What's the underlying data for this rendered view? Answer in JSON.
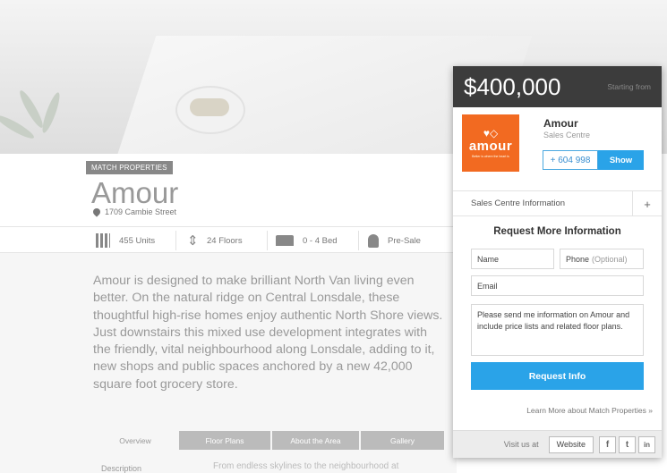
{
  "listing": {
    "tag": "MATCH PROPERTIES",
    "title": "Amour",
    "address": "1709 Cambie Street"
  },
  "stats": [
    {
      "icon": "building-icon",
      "label": "455 Units"
    },
    {
      "icon": "height-icon",
      "label": "24 Floors"
    },
    {
      "icon": "bed-icon",
      "label": "0 - 4 Bed"
    },
    {
      "icon": "person-icon",
      "label": "Pre-Sale"
    }
  ],
  "description": "Amour is designed to make brilliant North Van living even better. On the natural ridge on Central Lonsdale, these thoughtful high-rise homes enjoy authentic North Shore views. Just downstairs this mixed use development integrates with the friendly, vital neighbourhood along Lonsdale, adding to it, new shops and public spaces anchored by a new 42,000 square foot grocery store.",
  "tabs": [
    "Overview",
    "Floor Plans",
    "About the Area",
    "Gallery"
  ],
  "bottom": {
    "label": "Description",
    "text": "From endless skylines to the neighbourhood at"
  },
  "panel": {
    "price": "$400,000",
    "starting": "Starting from",
    "logo": {
      "word": "amour",
      "tagline": "Better is where the heart is"
    },
    "builder_name": "Amour",
    "builder_sub": "Sales Centre",
    "phone": "+ 604 998",
    "show": "Show",
    "accordion": "Sales Centre Information",
    "accordion_toggle": "+",
    "form_title": "Request More Information",
    "name_placeholder": "Name",
    "phone_placeholder": "Phone",
    "phone_optional": "(Optional)",
    "email_placeholder": "Email",
    "message": "Please send me information on Amour and include price lists and related floor plans.",
    "request_btn": "Request Info",
    "learn_more": "Learn More about Match Properties »",
    "visit": "Visit us at",
    "website": "Website",
    "social": [
      "f",
      "t",
      "in"
    ]
  },
  "colors": {
    "accent": "#2aa3e8",
    "logo_bg": "#f26a21",
    "price_bar": "#3c3c3c"
  }
}
